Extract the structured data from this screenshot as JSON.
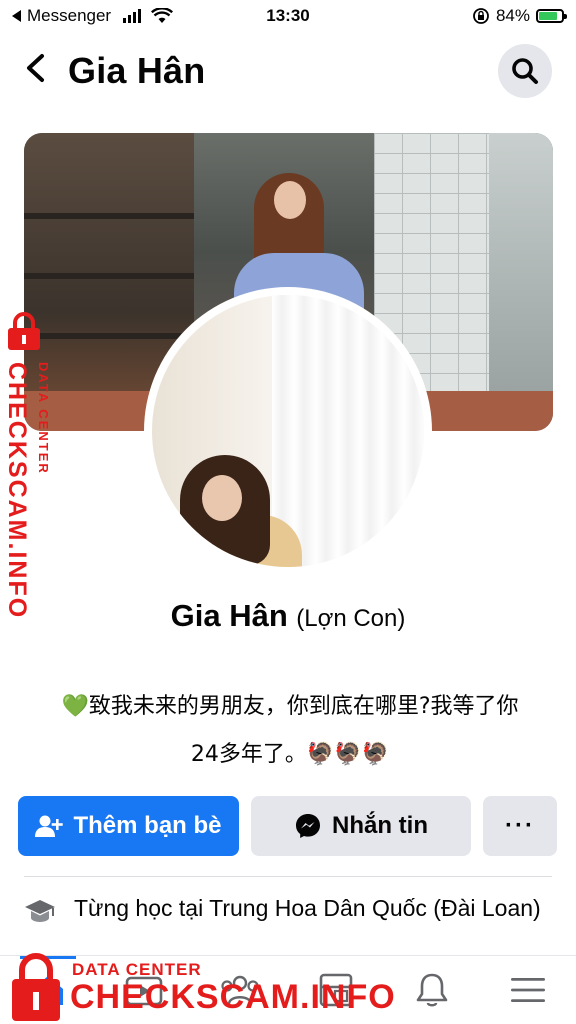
{
  "status_bar": {
    "back_app": "Messenger",
    "time": "13:30",
    "battery": "84%",
    "battery_level": 0.84
  },
  "header": {
    "title": "Gia Hân"
  },
  "profile": {
    "name": "Gia Hân",
    "alternate_name": "(Lợn Con)",
    "bio_line1": "💚致我未来的男朋友，你到底在哪里?我等了你",
    "bio_line2": "24多年了。🦃🦃🦃"
  },
  "actions": {
    "add_friend": "Thêm bạn bè",
    "message": "Nhắn tin",
    "more": "···"
  },
  "intro": {
    "education": "Từng học tại Trung Hoa Dân Quốc (Đài Loan)"
  },
  "watermark": {
    "side_big": "CHECKSCAM.INFO",
    "side_small": "DATA CENTER",
    "bottom_small": "DATA CENTER",
    "bottom_big": "CHECKSCAM.INFO"
  },
  "colors": {
    "accent": "#1877f2",
    "button_gray": "#e4e6eb",
    "watermark_red": "#e51c1c"
  },
  "icons": [
    "back-arrow-icon",
    "search-icon",
    "add-friend-icon",
    "messenger-icon",
    "graduation-cap-icon",
    "home-icon",
    "watch-icon",
    "groups-icon",
    "pages-icon",
    "bell-icon",
    "menu-icon",
    "lock-icon"
  ]
}
